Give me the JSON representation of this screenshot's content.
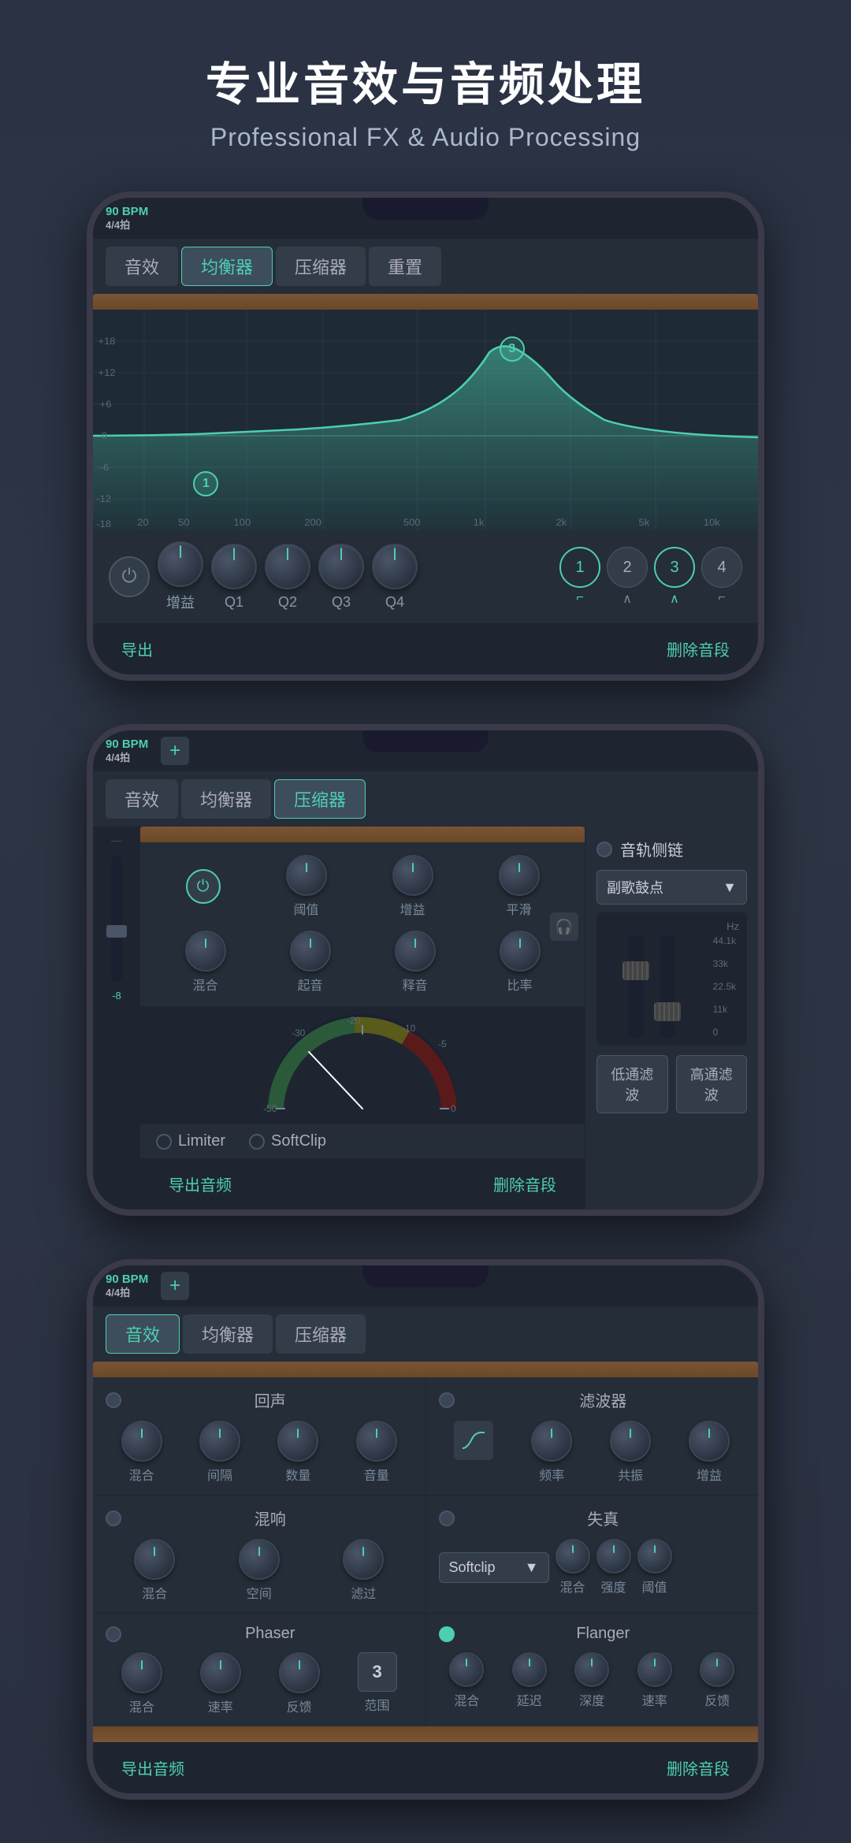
{
  "header": {
    "title_cn": "专业音效与音频处理",
    "title_en": "Professional FX & Audio Processing"
  },
  "screen1": {
    "bpm": "90 BPM",
    "time_sig": "4/4拍",
    "tabs": [
      "音效",
      "均衡器",
      "压缩器",
      "重置"
    ],
    "active_tab": 1,
    "db_labels": [
      "+18",
      "+12",
      "+6",
      "0",
      "-6",
      "-12",
      "-18"
    ],
    "freq_labels": [
      "20",
      "50",
      "100",
      "200",
      "500",
      "1k",
      "2k",
      "5k",
      "10k"
    ],
    "eq_points": [
      {
        "band": "1",
        "x": 17,
        "y": 79
      },
      {
        "band": "3",
        "x": 72,
        "y": 18
      }
    ],
    "knobs": [
      "增益",
      "Q1",
      "Q2",
      "Q3",
      "Q4"
    ],
    "band_btns": [
      "1",
      "2",
      "3",
      "4"
    ],
    "band_icons": [
      "⌐",
      "∧",
      "∧",
      "⌐"
    ],
    "export_btn": "导出",
    "delete_btn": "删除音段"
  },
  "screen2": {
    "bpm": "90 BPM",
    "time_sig": "4/4拍",
    "tabs": [
      "音效",
      "均衡器",
      "压缩器"
    ],
    "active_tab": 2,
    "sidechain_label": "音轨侧链",
    "drum_selector": "副歌鼓点",
    "freq_values": [
      "Hz",
      "44.1k",
      "33k",
      "22.5k",
      "11k",
      "0"
    ],
    "comp_knobs": [
      "阈值",
      "增益",
      "平滑",
      "混合",
      "起音",
      "释音",
      "比率"
    ],
    "filter_btns": [
      "低通滤波",
      "高通滤波"
    ],
    "options": [
      "Limiter",
      "SoftClip"
    ],
    "export_btn": "导出音频",
    "delete_btn": "删除音段"
  },
  "screen3": {
    "bpm": "90 BPM",
    "time_sig": "4/4拍",
    "tabs": [
      "音效",
      "均衡器",
      "压缩器"
    ],
    "active_tab": 0,
    "sections": [
      {
        "id": "reverb",
        "title": "回声",
        "knobs": [
          "混合",
          "间隔",
          "数量",
          "音量"
        ]
      },
      {
        "id": "filter",
        "title": "滤波器",
        "knobs": [
          "频率",
          "共振",
          "增益"
        ]
      },
      {
        "id": "chorus",
        "title": "混响",
        "knobs": [
          "混合",
          "空间",
          "滤过"
        ]
      },
      {
        "id": "distortion",
        "title": "失真",
        "selector": "Softclip",
        "knobs": [
          "混合",
          "强度",
          "阈值"
        ]
      },
      {
        "id": "phaser",
        "title": "Phaser",
        "knobs": [
          "混合",
          "速率",
          "反馈"
        ],
        "value_box": "3",
        "value_label": "范围"
      },
      {
        "id": "flanger",
        "title": "Flanger",
        "knobs": [
          "混合",
          "延迟",
          "深度",
          "速率",
          "反馈"
        ]
      }
    ],
    "export_btn": "导出音频",
    "delete_btn": "删除音段"
  },
  "colors": {
    "accent": "#4dcfb0",
    "bg_dark": "#1e2530",
    "bg_mid": "#252d38",
    "bg_light": "#333d4a",
    "text_primary": "#ffffff",
    "text_secondary": "#aab8cc",
    "text_muted": "#778899",
    "wood": "#7a5535"
  }
}
